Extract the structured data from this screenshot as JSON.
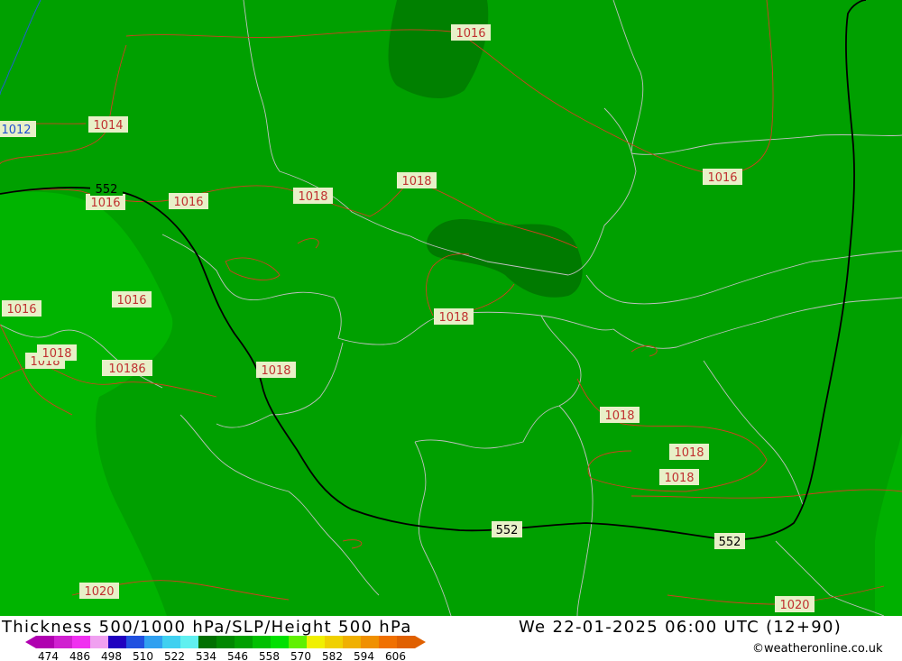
{
  "title": "Thickness 500/1000 hPa/SLP/Height 500 hPa",
  "datetime": "We 22-01-2025 06:00 UTC (12+90)",
  "credit": "©weatheronline.co.uk",
  "legend": {
    "ticks": [
      "474",
      "486",
      "498",
      "510",
      "522",
      "534",
      "546",
      "558",
      "570",
      "582",
      "594",
      "606"
    ],
    "colors": [
      "#b000b0",
      "#d020d0",
      "#f030f0",
      "#f0a0f0",
      "#2000c0",
      "#2050e0",
      "#30a0f0",
      "#40d0f0",
      "#60f0f0",
      "#007000",
      "#008800",
      "#00a000",
      "#00c000",
      "#00e000",
      "#60f000",
      "#f0f000",
      "#f0d000",
      "#f0b000",
      "#f09000",
      "#f07000",
      "#e06000"
    ]
  },
  "isobar_labels": [
    {
      "text": "1016",
      "kind": "slp"
    },
    {
      "text": "1014",
      "kind": "slp"
    },
    {
      "text": "1012",
      "kind": "slp_low"
    },
    {
      "text": "1016",
      "kind": "slp"
    },
    {
      "text": "1016",
      "kind": "slp"
    },
    {
      "text": "1018",
      "kind": "slp"
    },
    {
      "text": "1018",
      "kind": "slp"
    },
    {
      "text": "1016",
      "kind": "slp"
    },
    {
      "text": "1016",
      "kind": "slp"
    },
    {
      "text": "1016",
      "kind": "slp"
    },
    {
      "text": "1018",
      "kind": "slp"
    },
    {
      "text": "1018",
      "kind": "slp"
    },
    {
      "text": "1018",
      "kind": "slp"
    },
    {
      "text": "10186",
      "kind": "slp"
    },
    {
      "text": "1018",
      "kind": "slp"
    },
    {
      "text": "1018",
      "kind": "slp"
    },
    {
      "text": "1018",
      "kind": "slp"
    },
    {
      "text": "1018",
      "kind": "slp"
    },
    {
      "text": "1020",
      "kind": "slp"
    },
    {
      "text": "1020",
      "kind": "slp"
    }
  ],
  "height_labels": [
    {
      "text": "552"
    },
    {
      "text": "552"
    },
    {
      "text": "552"
    }
  ]
}
